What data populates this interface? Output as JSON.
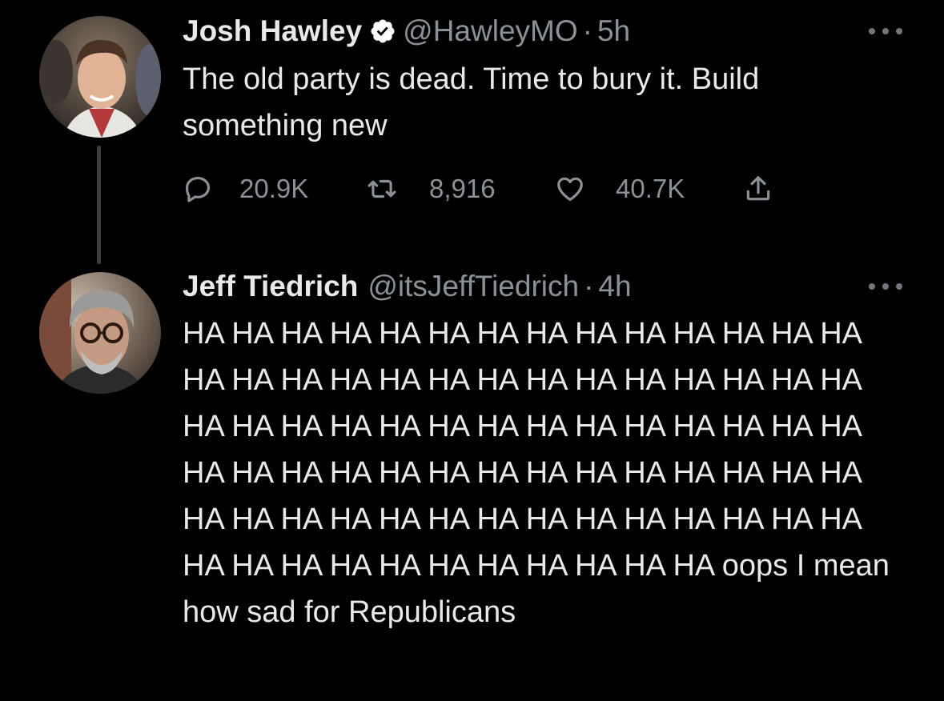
{
  "tweets": [
    {
      "author": "Josh Hawley",
      "verified": true,
      "handle": "@HawleyMO",
      "separator": "·",
      "time": "5h",
      "text": "The old party is dead. Time to bury it. Build something new",
      "actions": {
        "reply": {
          "icon": "reply-icon",
          "count": "20.9K"
        },
        "retweet": {
          "icon": "retweet-icon",
          "count": "8,916"
        },
        "like": {
          "icon": "heart-icon",
          "count": "40.7K"
        },
        "share": {
          "icon": "share-icon"
        }
      }
    },
    {
      "author": "Jeff Tiedrich",
      "verified": false,
      "handle": "@itsJeffTiedrich",
      "separator": "·",
      "time": "4h",
      "text": "HA HA HA HA HA HA HA HA HA HA HA HA HA HA HA HA HA HA HA HA HA HA HA HA HA HA HA HA HA HA HA HA HA HA HA HA HA HA HA HA HA HA HA HA HA HA HA HA HA HA HA HA HA HA HA HA HA HA HA HA HA HA HA HA HA HA HA HA HA HA HA HA HA HA HA HA HA HA HA HA HA oops I mean how sad for Republicans"
    }
  ],
  "colors": {
    "background": "#000000",
    "primary_text": "#e7e9ea",
    "secondary_text": "#8b9196",
    "verified_badge": "#ffffff",
    "thread_line": "#3a3d40"
  }
}
